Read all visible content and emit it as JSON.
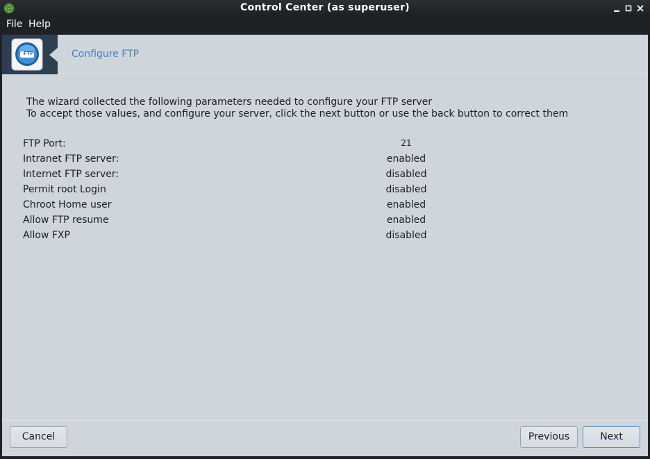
{
  "window": {
    "title": "Control Center (as superuser)",
    "controls": [
      "minimize-icon",
      "maximize-icon",
      "close-icon"
    ]
  },
  "menubar": {
    "file": "File",
    "help": "Help"
  },
  "banner": {
    "icon": "ftp-icon",
    "icon_text": "FTP",
    "title": "Configure FTP"
  },
  "intro": {
    "line1": "The wizard collected the following parameters needed to configure your FTP server",
    "line2": "To accept those values, and configure your server, click the next button or use the back button to correct them"
  },
  "params": [
    {
      "label": "FTP Port:",
      "value": "21"
    },
    {
      "label": "Intranet FTP server:",
      "value": "enabled"
    },
    {
      "label": "Internet FTP server:",
      "value": "disabled"
    },
    {
      "label": "Permit root Login",
      "value": "disabled"
    },
    {
      "label": "Chroot Home user",
      "value": "enabled"
    },
    {
      "label": "Allow FTP resume",
      "value": "enabled"
    },
    {
      "label": "Allow FXP",
      "value": "disabled"
    }
  ],
  "buttons": {
    "cancel": "Cancel",
    "previous": "Previous",
    "next": "Next"
  },
  "colors": {
    "accent": "#4a7fc2",
    "titlebar": "#1e2226",
    "body": "#cfd6db",
    "banner_icon_bg": "#2f3f52"
  }
}
